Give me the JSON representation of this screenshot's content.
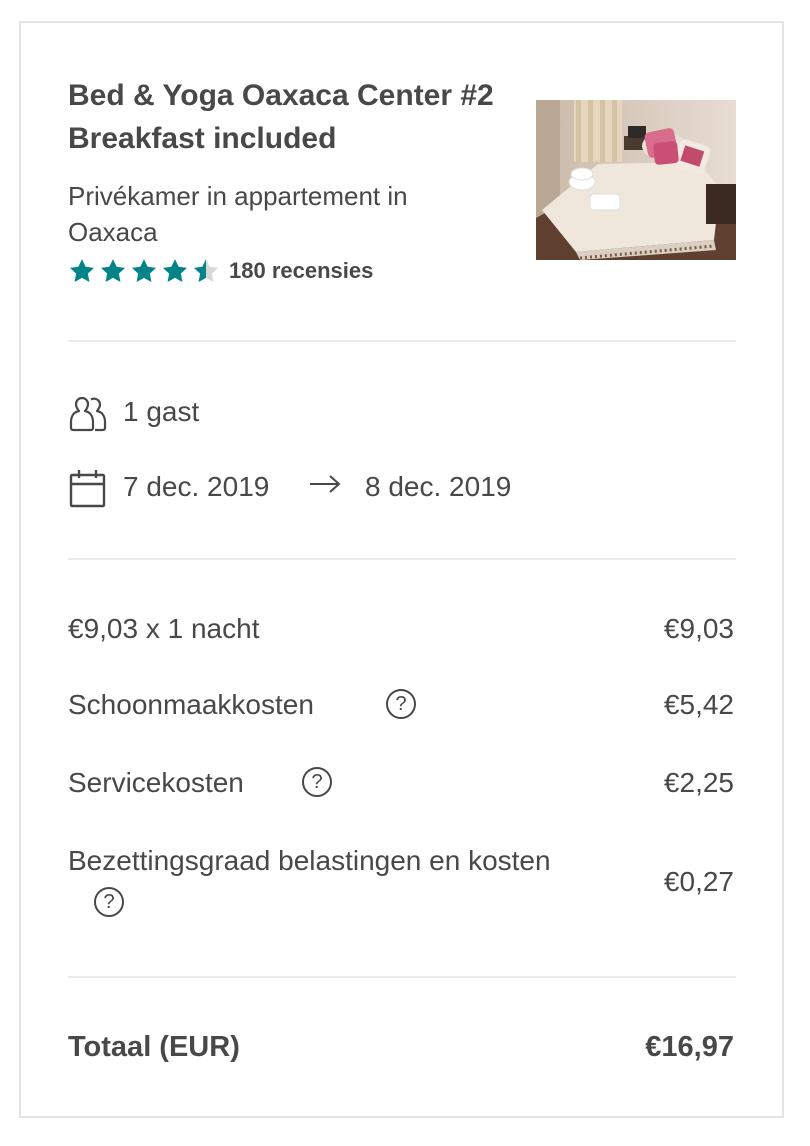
{
  "listing": {
    "title": "Bed & Yoga Oaxaca Center #2 Breakfast included",
    "subtitle": "Privékamer in appartement in Oaxaca",
    "rating": {
      "stars": 4.5,
      "max": 5,
      "reviews_label": "180 recensies"
    }
  },
  "trip": {
    "guests": "1 gast",
    "checkin": "7 dec. 2019",
    "checkout": "8 dec. 2019"
  },
  "price_breakdown": [
    {
      "label": "€9,03 x 1 nacht",
      "amount": "€9,03",
      "help": false
    },
    {
      "label": "Schoonmaakkosten",
      "amount": "€5,42",
      "help": true
    },
    {
      "label": "Servicekosten",
      "amount": "€2,25",
      "help": true
    },
    {
      "label": "Bezettingsgraad belastingen en kosten",
      "amount": "€0,27",
      "help": true
    }
  ],
  "total": {
    "label": "Totaal (EUR)",
    "amount": "€16,97"
  },
  "help_glyph": "?",
  "colors": {
    "star": "#008489",
    "text": "#484848",
    "divider": "#ebebeb"
  },
  "icons": {
    "guests": "guests-icon",
    "calendar": "calendar-icon",
    "arrow": "arrow-right-icon",
    "help": "question-circle-icon"
  }
}
